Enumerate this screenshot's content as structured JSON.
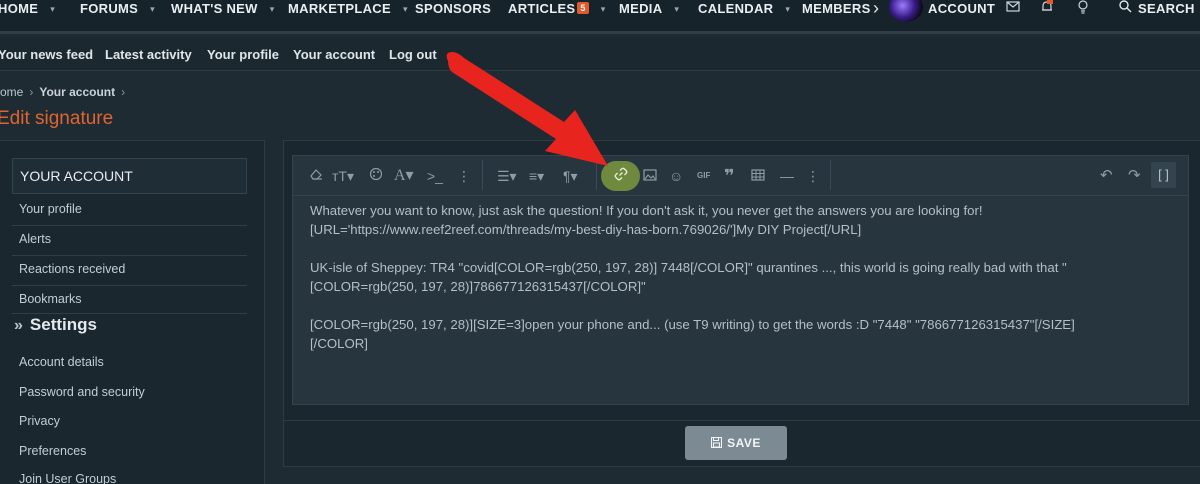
{
  "top_nav": {
    "items": [
      {
        "label": "HOME",
        "caret": "▾"
      },
      {
        "label": "FORUMS",
        "caret": "▾"
      },
      {
        "label": "WHAT'S NEW",
        "caret": "▾"
      },
      {
        "label": "MARKETPLACE",
        "caret": "▾"
      },
      {
        "label": "SPONSORS",
        "caret": ""
      },
      {
        "label": "ARTICLES",
        "caret": "▾",
        "badge": "5"
      },
      {
        "label": "MEDIA",
        "caret": "▾"
      },
      {
        "label": "CALENDAR",
        "caret": "▾"
      },
      {
        "label": "MEMBERS",
        "caret": ""
      }
    ],
    "more_icon": "chevron-right-icon",
    "account_label": "ACCOUNT",
    "icons": [
      "envelope-icon",
      "bell-icon",
      "lightbulb-icon"
    ],
    "search_label": "SEARCH"
  },
  "sub_nav": {
    "items": [
      "Your news feed",
      "Latest activity",
      "Your profile",
      "Your account",
      "Log out"
    ]
  },
  "breadcrumb": {
    "home": "ome",
    "current": "Your account"
  },
  "page_title": "Edit signature",
  "sidebar": {
    "header": "YOUR ACCOUNT",
    "items": [
      "Your profile",
      "Alerts",
      "Reactions received",
      "Bookmarks"
    ],
    "section_title": "Settings",
    "settings_items": [
      "Account details",
      "Password and security",
      "Privacy",
      "Preferences",
      "Join User Groups"
    ]
  },
  "editor": {
    "toolbar": {
      "buttons": [
        "eraser-icon",
        "text-size-icon",
        "palette-icon",
        "font-color-icon",
        "code-icon",
        "more-icon",
        "list-icon",
        "align-icon",
        "paragraph-icon",
        "link-icon",
        "image-icon",
        "smiley-icon",
        "gif-icon",
        "quote-icon",
        "table-icon",
        "hr-icon",
        "more-icon-2",
        "undo-icon",
        "redo-icon",
        "bbcode-toggle-icon"
      ],
      "highlighted": "link-icon",
      "gif_label": "GIF"
    },
    "content": {
      "line1": "Whatever you want to know, just ask the question! If you don't ask it, you never get the answers you are looking for!",
      "line2": "[URL='https://www.reef2reef.com/threads/my-best-diy-has-born.769026/']My DIY Project[/URL]",
      "line3": "UK-isle of Sheppey: TR4  \"covid[COLOR=rgb(250, 197, 28)] 7448[/COLOR]\" qurantines ..., this world is going really bad with that \"",
      "line4": "[COLOR=rgb(250, 197, 28)]786677126315437[/COLOR]\"",
      "line5": "[COLOR=rgb(250, 197, 28)][SIZE=3]open your phone and... (use T9 writing) to get the words :D \"7448\" \"786677126315437\"[/SIZE]",
      "line6": "[/COLOR]"
    }
  },
  "save_button": {
    "label": "SAVE",
    "icon": "save-icon"
  },
  "annotation": {
    "type": "red-arrow",
    "points_to": "link-icon",
    "color": "#e8241f"
  },
  "colors": {
    "accent": "#e0642f",
    "background": "#1f2b33",
    "link_highlight": "#6f8a3e"
  }
}
